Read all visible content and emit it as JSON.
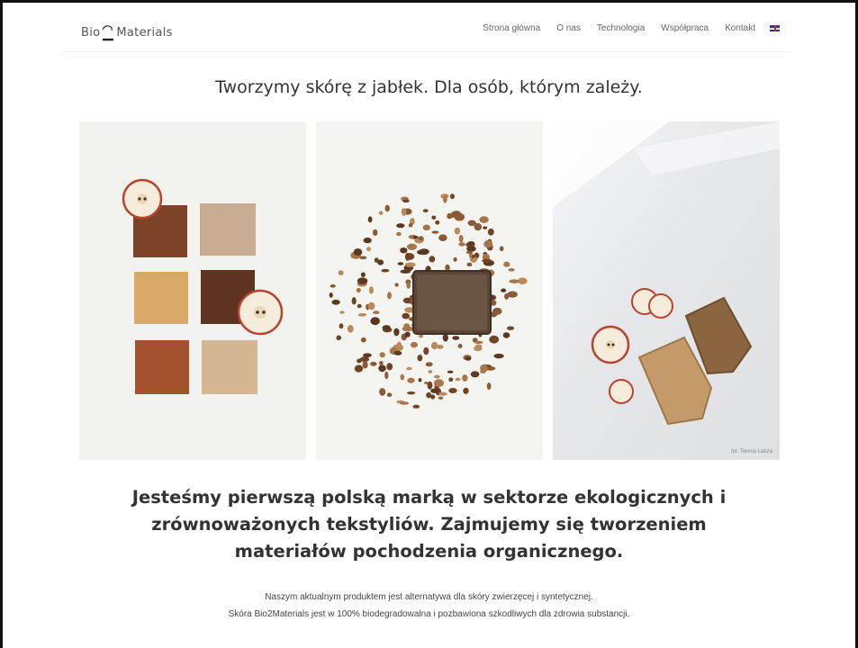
{
  "brand": {
    "logo_left": "Bio",
    "logo_right": "Materials"
  },
  "nav": {
    "items": [
      {
        "label": "Strona główna"
      },
      {
        "label": "O nas"
      },
      {
        "label": "Technologia"
      },
      {
        "label": "Współpraca"
      },
      {
        "label": "Kontakt"
      }
    ],
    "language_icon": "uk-flag-icon"
  },
  "hero": {
    "tagline": "Tworzymy skórę z jabłek. Dla osób, którym zależy.",
    "photo_credit": "fot. Teresa Łabza"
  },
  "about": {
    "headline": "Jesteśmy pierwszą polską marką w sektorze ekologicznych i zrównoważonych tekstyliów. Zajmujemy się tworzeniem materiałów pochodzenia organicznego.",
    "line1": "Naszym aktualnym produktem jest alternatywa dla skóry zwierzęcej i syntetycznej.",
    "line2": "Skóra Bio2Materials jest w 100% biodegradowalna i pozbawiona szkodliwych dla zdrowia substancji."
  },
  "colors": {
    "text": "#333333",
    "leather_dark": "#7a3e22",
    "leather_light": "#c9a882"
  }
}
